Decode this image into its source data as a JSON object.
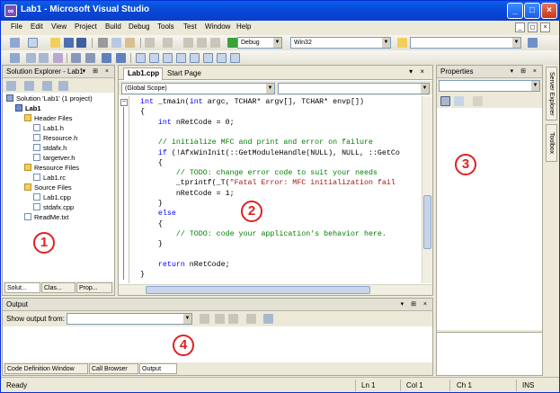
{
  "window": {
    "title": "Lab1 - Microsoft Visual Studio",
    "icon_label": "∞"
  },
  "window_buttons": {
    "minimize": "_",
    "maximize": "□",
    "close": "×"
  },
  "menu": [
    "File",
    "Edit",
    "View",
    "Project",
    "Build",
    "Debug",
    "Tools",
    "Test",
    "Window",
    "Help"
  ],
  "mdi_buttons": {
    "minimize": "_",
    "restore": "◻",
    "close": "×"
  },
  "toolbar": {
    "config": "Debug",
    "platform": "Win32",
    "find_value": ""
  },
  "solution_explorer": {
    "title": "Solution Explorer - Lab1",
    "header_buttons": "▾ ⊞ ×",
    "tree": [
      {
        "label": "Solution 'Lab1' (1 project)",
        "level": 0,
        "kind": "solution"
      },
      {
        "label": "Lab1",
        "level": 1,
        "kind": "project",
        "bold": true
      },
      {
        "label": "Header Files",
        "level": 2,
        "kind": "folder"
      },
      {
        "label": "Lab1.h",
        "level": 3,
        "kind": "file"
      },
      {
        "label": "Resource.h",
        "level": 3,
        "kind": "file"
      },
      {
        "label": "stdafx.h",
        "level": 3,
        "kind": "file"
      },
      {
        "label": "targetver.h",
        "level": 3,
        "kind": "file"
      },
      {
        "label": "Resource Files",
        "level": 2,
        "kind": "folder"
      },
      {
        "label": "Lab1.rc",
        "level": 3,
        "kind": "file"
      },
      {
        "label": "Source Files",
        "level": 2,
        "kind": "folder"
      },
      {
        "label": "Lab1.cpp",
        "level": 3,
        "kind": "file"
      },
      {
        "label": "stdafx.cpp",
        "level": 3,
        "kind": "file"
      },
      {
        "label": "ReadMe.txt",
        "level": 2,
        "kind": "file"
      }
    ],
    "tabs": [
      "Solut...",
      "Clas...",
      "Prop..."
    ]
  },
  "editor": {
    "tabs": [
      "Lab1.cpp",
      "Start Page"
    ],
    "tab_controls": "▾ ×",
    "scope": "(Global Scope)",
    "member": "",
    "code_lines": [
      [
        {
          "t": "int",
          "c": "kw"
        },
        {
          "t": " _tmain("
        },
        {
          "t": "int",
          "c": "kw"
        },
        {
          "t": " argc, TCHAR* argv[], TCHAR* envp[])"
        }
      ],
      [
        {
          "t": "{"
        }
      ],
      [
        {
          "t": "    "
        },
        {
          "t": "int",
          "c": "kw"
        },
        {
          "t": " nRetCode = 0;"
        }
      ],
      [
        {
          "t": ""
        }
      ],
      [
        {
          "t": "    "
        },
        {
          "t": "// initialize MFC and print and error on failure",
          "c": "cm"
        }
      ],
      [
        {
          "t": "    "
        },
        {
          "t": "if",
          "c": "kw"
        },
        {
          "t": " (!AfxWinInit(::GetModuleHandle(NULL), NULL, ::GetCo"
        }
      ],
      [
        {
          "t": "    {"
        }
      ],
      [
        {
          "t": "        "
        },
        {
          "t": "// TODO: change error code to suit your needs",
          "c": "cm"
        }
      ],
      [
        {
          "t": "        _tprintf(_T("
        },
        {
          "t": "\"Fatal Error: MFC initialization fail",
          "c": "st"
        }
      ],
      [
        {
          "t": "        nRetCode = 1;"
        }
      ],
      [
        {
          "t": "    }"
        }
      ],
      [
        {
          "t": "    "
        },
        {
          "t": "else",
          "c": "kw"
        }
      ],
      [
        {
          "t": "    {"
        }
      ],
      [
        {
          "t": "        "
        },
        {
          "t": "// TODO: code your application's behavior here.",
          "c": "cm"
        }
      ],
      [
        {
          "t": "    }"
        }
      ],
      [
        {
          "t": ""
        }
      ],
      [
        {
          "t": "    "
        },
        {
          "t": "return",
          "c": "kw"
        },
        {
          "t": " nRetCode;"
        }
      ],
      [
        {
          "t": "}"
        }
      ]
    ]
  },
  "properties": {
    "title": "Properties",
    "header_buttons": "▾ ⊞ ×",
    "object": ""
  },
  "side_tabs": [
    "Server Explorer",
    "Toolbox"
  ],
  "output": {
    "title": "Output",
    "header_buttons": "▾ ⊞ ×",
    "show_from_label": "Show output from:",
    "show_from_value": "",
    "tabs": [
      "Code Definition Window",
      "Call Browser",
      "Output"
    ]
  },
  "annotations": [
    "1",
    "2",
    "3",
    "4"
  ],
  "statusbar": {
    "text": "Ready",
    "ln": "Ln 1",
    "col": "Col 1",
    "ch": "Ch 1",
    "mode": "INS"
  },
  "colors": {
    "keyword": "#0000FF",
    "comment": "#008000",
    "string": "#A31515",
    "annotation": "#E02020",
    "titlebar": "#0A5FE8"
  }
}
